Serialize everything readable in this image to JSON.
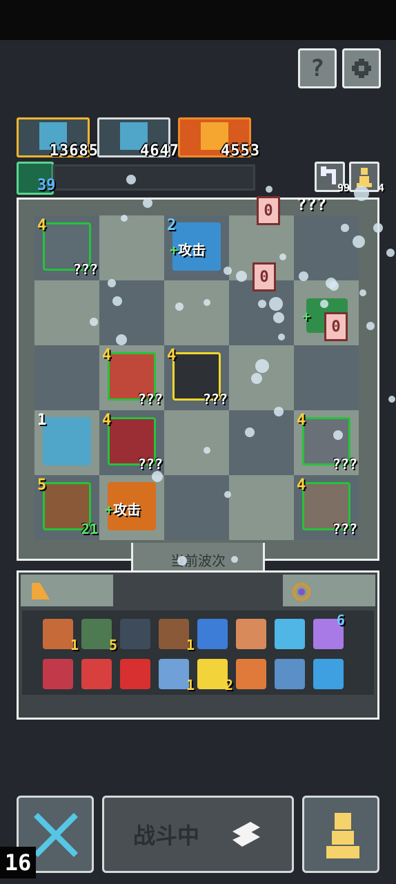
{
  "header": {
    "help_label": "?",
    "settings_icon": "gear-icon"
  },
  "portraits": [
    {
      "value": "13685",
      "frame": "#f2b630"
    },
    {
      "value": "4647",
      "frame": "#d8dcdc"
    },
    {
      "value": "4553",
      "frame": "#f08a2a"
    }
  ],
  "exp": {
    "level": "39"
  },
  "side_buttons": [
    {
      "icon": "undo-icon",
      "count": "99"
    },
    {
      "icon": "pawn-icon",
      "count": "4"
    }
  ],
  "board": {
    "wave_label": "当前波次",
    "enemy_counter_top": "0",
    "enemy_counter_mid": "0",
    "enemy_counter_right": "0",
    "enemy_unknown_top": "???",
    "units": [
      {
        "level": "4",
        "info": "???"
      },
      {
        "level": "2",
        "buff_plus": "+",
        "buff": "攻击"
      },
      {
        "level": "",
        "buff_plus": "+",
        "buff": ""
      },
      {
        "level": "4",
        "info": "???"
      },
      {
        "level": "4",
        "info": "???"
      },
      {
        "level": "1",
        "info": ""
      },
      {
        "level": "4",
        "info": "???"
      },
      {
        "level": "4",
        "info": "???"
      },
      {
        "level": "5",
        "info": "21"
      },
      {
        "level": "",
        "buff_plus": "+",
        "buff": "攻击"
      },
      {
        "level": "4",
        "info": "???"
      }
    ]
  },
  "inventory": {
    "items_row1": [
      {
        "icon": "drum-icon",
        "count": "1"
      },
      {
        "icon": "hooded-figure-icon",
        "count": "5"
      },
      {
        "icon": "shield-icon",
        "count": ""
      },
      {
        "icon": "spear-icon",
        "count": "1"
      },
      {
        "icon": "blue-ring-icon",
        "count": ""
      },
      {
        "icon": "tombstone-icon",
        "count": ""
      },
      {
        "icon": "blue-fish-icon",
        "count": ""
      },
      {
        "icon": "star-burst-icon",
        "count": "6"
      }
    ],
    "items_row2": [
      {
        "icon": "ribbon-icon",
        "count": ""
      },
      {
        "icon": "crosshair-icon",
        "count": ""
      },
      {
        "icon": "red-potion-icon",
        "count": ""
      },
      {
        "icon": "bow-icon",
        "count": "1"
      },
      {
        "icon": "rune-icon",
        "count": "2"
      },
      {
        "icon": "dagger-icon",
        "count": ""
      },
      {
        "icon": "anvil-icon",
        "count": ""
      },
      {
        "icon": "flask-icon",
        "count": ""
      }
    ]
  },
  "controls": {
    "fight_label": "战斗中",
    "corner_number": "16"
  }
}
